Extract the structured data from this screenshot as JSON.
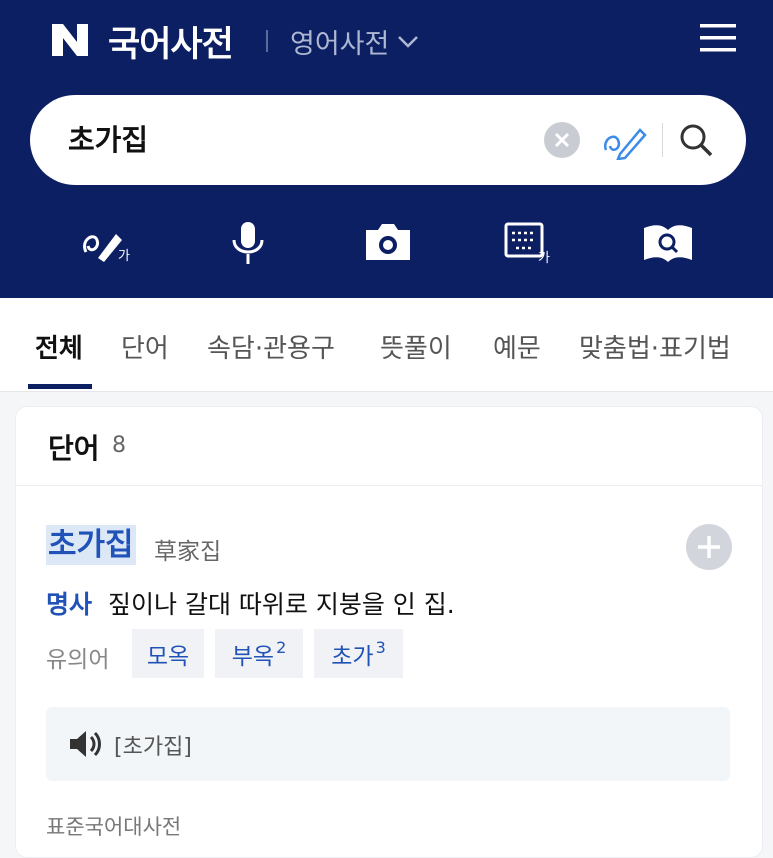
{
  "header": {
    "logo_letter": "N",
    "title": "국어사전",
    "dict_switch_label": "영어사전"
  },
  "search": {
    "value": "초가집"
  },
  "tabs": [
    "전체",
    "단어",
    "속담·관용구",
    "뜻풀이",
    "예문",
    "맞춤법·표기법"
  ],
  "active_tab": "전체",
  "section": {
    "title": "단어",
    "count": "8"
  },
  "entry": {
    "word": "초가집",
    "hanja": "草家집",
    "part_of_speech": "명사",
    "meaning": "짚이나 갈대 따위로 지붕을 인 집.",
    "synonym_label": "유의어",
    "synonyms": [
      {
        "text": "모옥",
        "sup": ""
      },
      {
        "text": "부옥",
        "sup": "2"
      },
      {
        "text": "초가",
        "sup": "3"
      }
    ],
    "pronunciation": "[초가집]",
    "source": "표준국어대사전"
  },
  "colors": {
    "header_bg": "#0c1f63",
    "accent_blue": "#2052b8",
    "highlight_bg": "#dde8f7"
  }
}
